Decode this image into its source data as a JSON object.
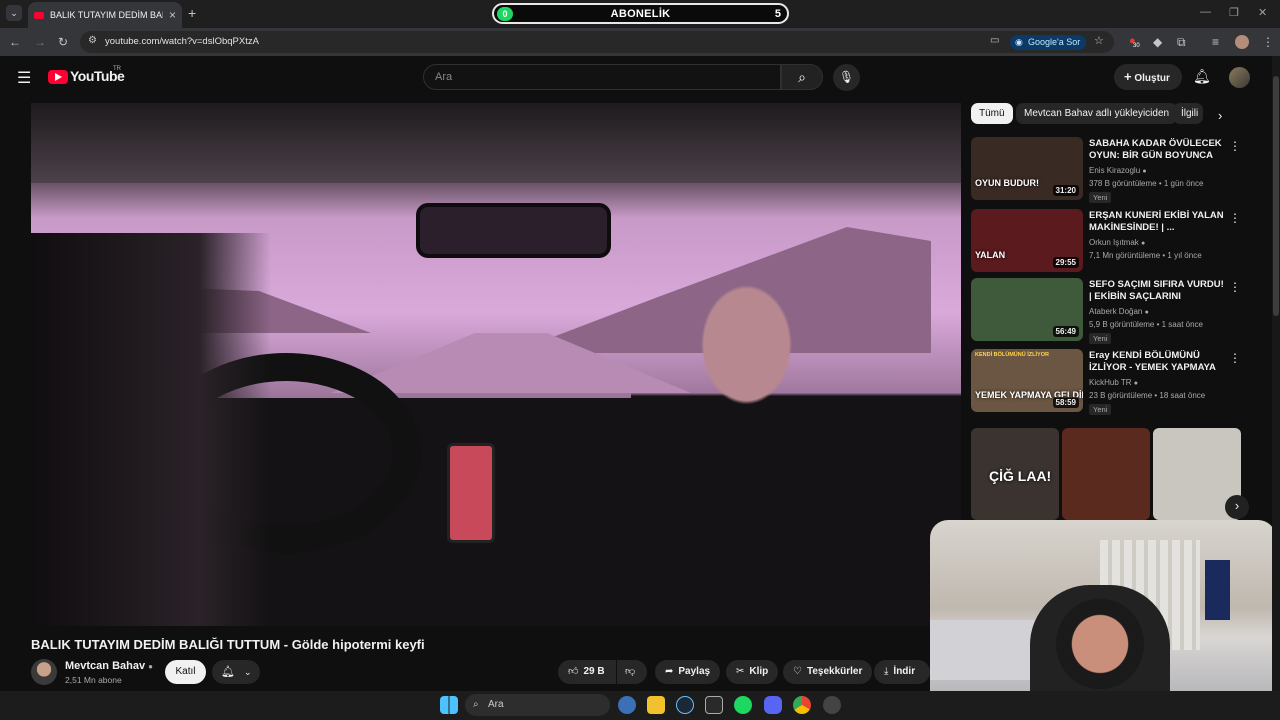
{
  "browser": {
    "tab_title": "BALIK TUTAYIM DEDİM BALIĞI TUTTUM",
    "url": "youtube.com/watch?v=dslObqPXtzA",
    "google_sor": "Google'a Sor",
    "extension_badge": "30"
  },
  "overlay": {
    "dot_value": "0",
    "label": "ABONELİK",
    "count": "5"
  },
  "masthead": {
    "logo_text": "YouTube",
    "logo_country": "TR",
    "search_placeholder": "Ara",
    "create_label": "Oluştur"
  },
  "video": {
    "title": "BALIK TUTAYIM DEDİM BALIĞI TUTTUM - Gölde hipotermi keyfi",
    "channel": "Mevtcan Bahav",
    "subscribers": "2,51 Mn abone",
    "join_label": "Katıl",
    "likes": "29 B",
    "share_label": "Paylaş",
    "clip_label": "Klip",
    "thanks_label": "Teşekkürler",
    "download_label": "İndir"
  },
  "chips": [
    "Tümü",
    "Mevtcan Bahav adlı yükleyiciden",
    "İlgili"
  ],
  "recommendations": [
    {
      "title": "SABAHA KADAR ÖVÜLECEK OYUN: BİR GÜN BOYUNCA GO...",
      "channel": "Enis Kirazoglu",
      "meta": "378 B görüntüleme • 1 gün önce",
      "badge": "Yeni",
      "duration": "31:20",
      "thumb_text": "OYUN BUDUR!",
      "thumb_color": "#3a2a24"
    },
    {
      "title": "ERŞAN KUNERİ EKİBİ YALAN MAKİNESİNDE! | ...",
      "channel": "Orkun Işıtmak",
      "meta": "7,1 Mn görüntüleme • 1 yıl önce",
      "badge": "",
      "duration": "29:55",
      "thumb_text": "YALAN",
      "thumb_color": "#5b1a1e"
    },
    {
      "title": "SEFO SAÇIMI SIFIRA VURDU! | EKİBİN SAÇLARINI RENGARE...",
      "channel": "Ataberk Doğan",
      "meta": "5,9 B görüntüleme • 1 saat önce",
      "badge": "Yeni",
      "duration": "56:49",
      "thumb_text": "",
      "thumb_color": "#3e5a3a"
    },
    {
      "title": "Eray KENDİ BÖLÜMÜNÜ İZLİYOR - YEMEK YAPMAYA ...",
      "channel": "KickHub TR",
      "meta": "23 B görüntüleme • 18 saat önce",
      "badge": "Yeni",
      "duration": "58:59",
      "thumb_text": "YEMEK YAPMAYA GELDİN, BAYAN YEDİK!",
      "thumb_text2": "KENDİ BÖLÜMÜNÜ İZLİYOR",
      "thumb_color": "#6a5642"
    }
  ],
  "shorts": [
    {
      "text": "ÇİĞ LAA!",
      "color": "#3a3330"
    },
    {
      "text": "",
      "color": "#5a2a1e"
    },
    {
      "text": "",
      "color": "#c9c5bf"
    }
  ],
  "taskbar": {
    "search_label": "Ara"
  }
}
